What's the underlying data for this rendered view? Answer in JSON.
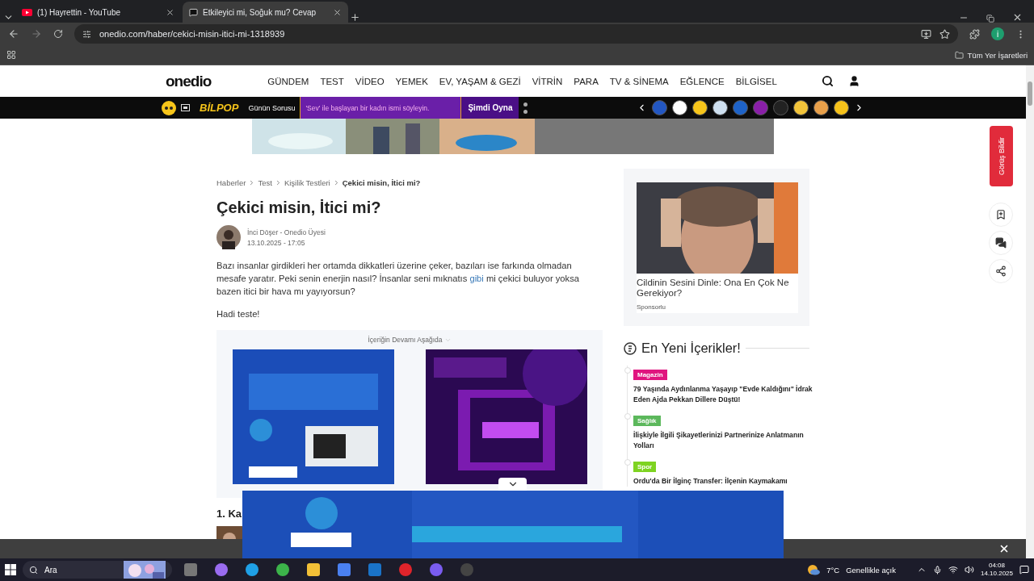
{
  "browser": {
    "tabs": [
      {
        "title": "(1) Hayrettin - YouTube",
        "selected": false
      },
      {
        "title": "Etkileyici mi, Soğuk mu? Cevap",
        "selected": true
      }
    ],
    "url": "onedio.com/haber/cekici-misin-itici-mi-1318939",
    "profile_initial": "i",
    "bookmarks_label": "Tüm Yer İşaretleri"
  },
  "site": {
    "logo": "onedio",
    "nav": [
      "GÜNDEM",
      "TEST",
      "VİDEO",
      "YEMEK",
      "EV, YAŞAM & GEZİ",
      "VİTRİN",
      "PARA",
      "TV & SİNEMA",
      "EĞLENCE",
      "BİLGİSEL"
    ],
    "quiz_bar": {
      "brand": "BİLPOP",
      "label": "Günün Sorusu",
      "question": "'Sev' ile başlayan bir kadın ismi söyleyin.",
      "play": "Şimdi Oyna"
    }
  },
  "article": {
    "breadcrumbs": [
      {
        "label": "Haberler",
        "current": false
      },
      {
        "label": "Test",
        "current": false
      },
      {
        "label": "Kişilik Testleri",
        "current": false
      },
      {
        "label": "Çekici misin, İtici mi?",
        "current": true
      }
    ],
    "title": "Çekici misin, İtici mi?",
    "author": "İnci Döşer - Onedio Üyesi",
    "date": "13.10.2025 - 17:05",
    "intro": [
      {
        "text": "Bazı insanlar girdikleri her ortamda dikkatleri üzerine çeker, bazıları ise farkında olmadan mesafe yaratır. Peki senin enerjin nasıl? İnsanlar seni mıknatıs ",
        "link": false
      },
      {
        "text": "gibi",
        "link": true
      },
      {
        "text": " mi çekici buluyor yoksa bazen itici bir hava mı yayıyorsun?",
        "link": false
      }
    ],
    "call": "Hadi teste!",
    "continue_label": "İçeriğin Devamı Aşağıda",
    "next_heading": "1. Ka"
  },
  "sidebar": {
    "sponsored": {
      "title": "Cildinin Sesini Dinle: Ona En Çok Ne Gerekiyor?",
      "label": "Sponsorlu"
    },
    "latest": {
      "heading": "En Yeni İçerikler!",
      "items": [
        {
          "tag": "Magazin",
          "color": "#e0157f",
          "title": "79 Yaşında Aydınlanma Yaşayıp \"Evde Kaldığını\" İdrak Eden Ajda Pekkan Dillere Düştü!"
        },
        {
          "tag": "Sağlık",
          "color": "#5cb85c",
          "title": "İlişkiyle İlgili Şikayetlerinizi Partnerinize Anlatmanın Yolları"
        },
        {
          "tag": "Spor",
          "color": "#7ed321",
          "title": "Ordu'da Bir İlginç Transfer: İlçenin Kaymakamı"
        }
      ]
    }
  },
  "feedback": "Görüş Bildir",
  "taskbar": {
    "search": "Ara",
    "temperature": "7°C",
    "weather": "Genellikle açık",
    "time": "04:08",
    "date": "14.10.2025"
  }
}
